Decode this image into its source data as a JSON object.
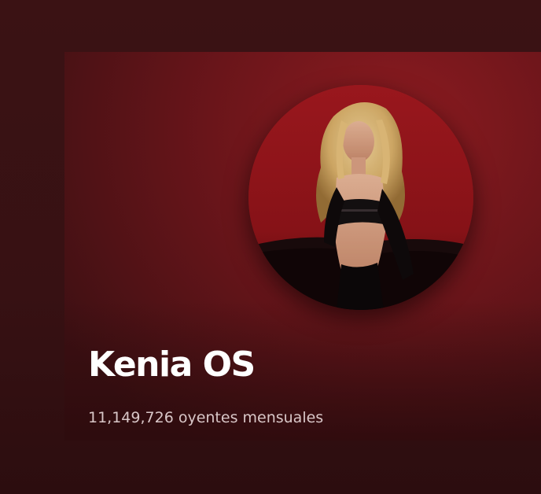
{
  "artist": {
    "name": "Kenia OS",
    "monthly_listeners": "11,149,726 oyentes mensuales"
  },
  "colors": {
    "background": "#3a1214",
    "banner": "#6a151a",
    "accent_red": "#8c1b20",
    "title_text": "#ffffff",
    "subtitle_text": "#d9c7c8"
  }
}
